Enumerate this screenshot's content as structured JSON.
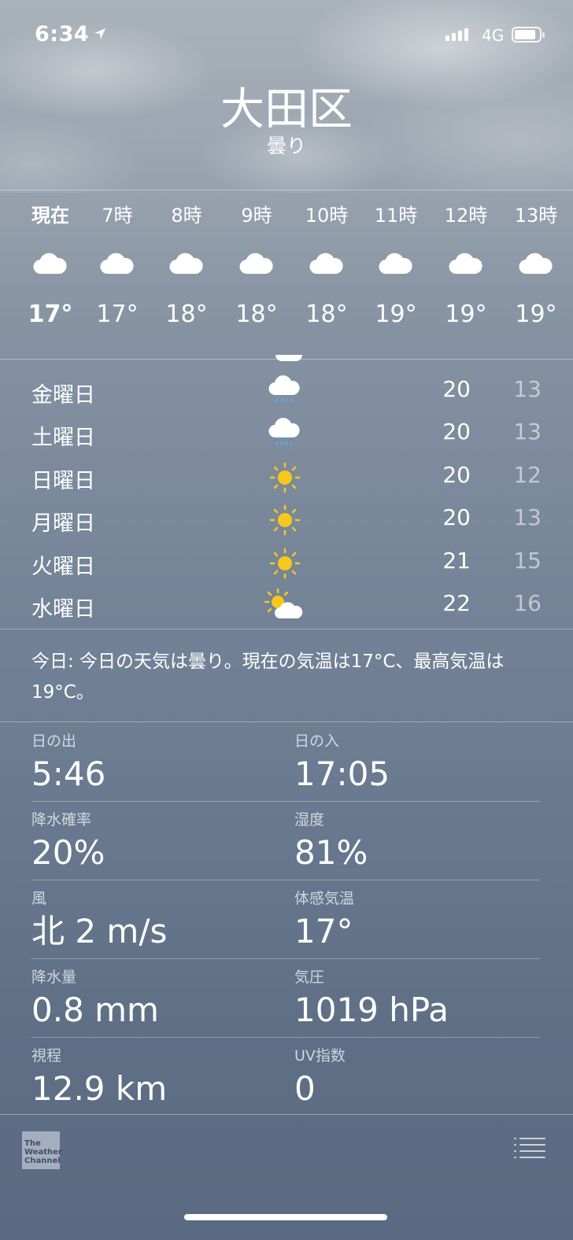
{
  "status_bar": {
    "time": "6:34",
    "network": "4G"
  },
  "header": {
    "city": "大田区",
    "condition": "曇り"
  },
  "hourly": [
    {
      "label": "現在",
      "icon": "cloud-icon",
      "temp": "17°"
    },
    {
      "label": "7時",
      "icon": "cloud-icon",
      "temp": "17°"
    },
    {
      "label": "8時",
      "icon": "cloud-icon",
      "temp": "18°"
    },
    {
      "label": "9時",
      "icon": "cloud-icon",
      "temp": "18°"
    },
    {
      "label": "10時",
      "icon": "cloud-icon",
      "temp": "18°"
    },
    {
      "label": "11時",
      "icon": "cloud-icon",
      "temp": "19°"
    },
    {
      "label": "12時",
      "icon": "cloud-icon",
      "temp": "19°"
    },
    {
      "label": "13時",
      "icon": "cloud-icon",
      "temp": "19°"
    }
  ],
  "daily": [
    {
      "day": "金曜日",
      "icon": "rain-icon",
      "high": "20",
      "low": "13"
    },
    {
      "day": "土曜日",
      "icon": "rain-icon",
      "high": "20",
      "low": "13"
    },
    {
      "day": "日曜日",
      "icon": "sun-icon",
      "high": "20",
      "low": "12"
    },
    {
      "day": "月曜日",
      "icon": "sun-icon",
      "high": "20",
      "low": "13"
    },
    {
      "day": "火曜日",
      "icon": "sun-icon",
      "high": "21",
      "low": "15"
    },
    {
      "day": "水曜日",
      "icon": "partly-cloudy-icon",
      "high": "22",
      "low": "16"
    }
  ],
  "summary": "今日: 今日の天気は曇り。現在の気温は17°C、最高気温は19°C。",
  "details": [
    {
      "label": "日の出",
      "value": "5:46"
    },
    {
      "label": "日の入",
      "value": "17:05"
    },
    {
      "label": "降水確率",
      "value": "20%"
    },
    {
      "label": "湿度",
      "value": "81%"
    },
    {
      "label": "風",
      "value": "北 2 m/s"
    },
    {
      "label": "体感気温",
      "value": "17°"
    },
    {
      "label": "降水量",
      "value": "0.8 mm"
    },
    {
      "label": "気圧",
      "value": "1019 hPa"
    },
    {
      "label": "視程",
      "value": "12.9 km"
    },
    {
      "label": "UV指数",
      "value": "0"
    }
  ],
  "footer": {
    "logo_text": "The Weather Channel"
  },
  "colors": {
    "sun": "#f7c81c",
    "rain": "#5aa9e6",
    "sky_top": "#aab2ba",
    "sky_bottom": "#5a6a82"
  }
}
